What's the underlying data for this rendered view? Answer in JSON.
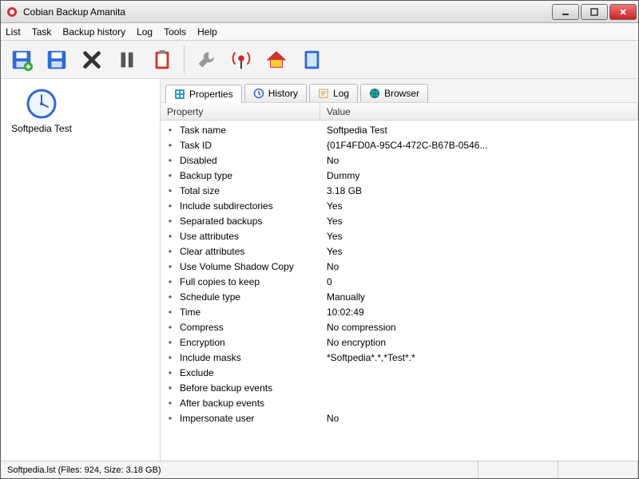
{
  "window": {
    "title": "Cobian Backup Amanita"
  },
  "menu": {
    "items": [
      "List",
      "Task",
      "Backup history",
      "Log",
      "Tools",
      "Help"
    ]
  },
  "toolbar": {
    "buttons": [
      {
        "name": "new-task-icon"
      },
      {
        "name": "save-icon"
      },
      {
        "name": "delete-icon"
      },
      {
        "name": "pause-icon"
      },
      {
        "name": "clipboard-icon"
      }
    ],
    "buttons2": [
      {
        "name": "settings-icon"
      },
      {
        "name": "broadcast-icon"
      },
      {
        "name": "home-icon"
      },
      {
        "name": "help-icon"
      }
    ]
  },
  "sidebar": {
    "task_label": "Softpedia Test"
  },
  "tabs": {
    "items": [
      {
        "label": "Properties",
        "active": true
      },
      {
        "label": "History",
        "active": false
      },
      {
        "label": "Log",
        "active": false
      },
      {
        "label": "Browser",
        "active": false
      }
    ]
  },
  "columns": {
    "property": "Property",
    "value": "Value"
  },
  "properties": [
    {
      "name": "Task name",
      "value": "Softpedia Test"
    },
    {
      "name": "Task ID",
      "value": "{01F4FD0A-95C4-472C-B67B-0546..."
    },
    {
      "name": "Disabled",
      "value": "No"
    },
    {
      "name": "Backup type",
      "value": "Dummy"
    },
    {
      "name": "Total size",
      "value": "3.18 GB"
    },
    {
      "name": "Include subdirectories",
      "value": "Yes"
    },
    {
      "name": "Separated backups",
      "value": "Yes"
    },
    {
      "name": "Use attributes",
      "value": "Yes"
    },
    {
      "name": "Clear attributes",
      "value": "Yes"
    },
    {
      "name": "Use Volume Shadow Copy",
      "value": "No"
    },
    {
      "name": "Full copies to keep",
      "value": "0"
    },
    {
      "name": "Schedule type",
      "value": "Manually"
    },
    {
      "name": "Time",
      "value": "10:02:49"
    },
    {
      "name": "Compress",
      "value": "No compression"
    },
    {
      "name": "Encryption",
      "value": "No encryption"
    },
    {
      "name": "Include masks",
      "value": "*Softpedia*.*,*Test*.*"
    },
    {
      "name": "Exclude",
      "value": ""
    },
    {
      "name": "Before backup events",
      "value": ""
    },
    {
      "name": "After backup events",
      "value": ""
    },
    {
      "name": "Impersonate user",
      "value": "No"
    }
  ],
  "statusbar": {
    "text": "Softpedia.lst (Files: 924, Size: 3.18 GB)"
  }
}
